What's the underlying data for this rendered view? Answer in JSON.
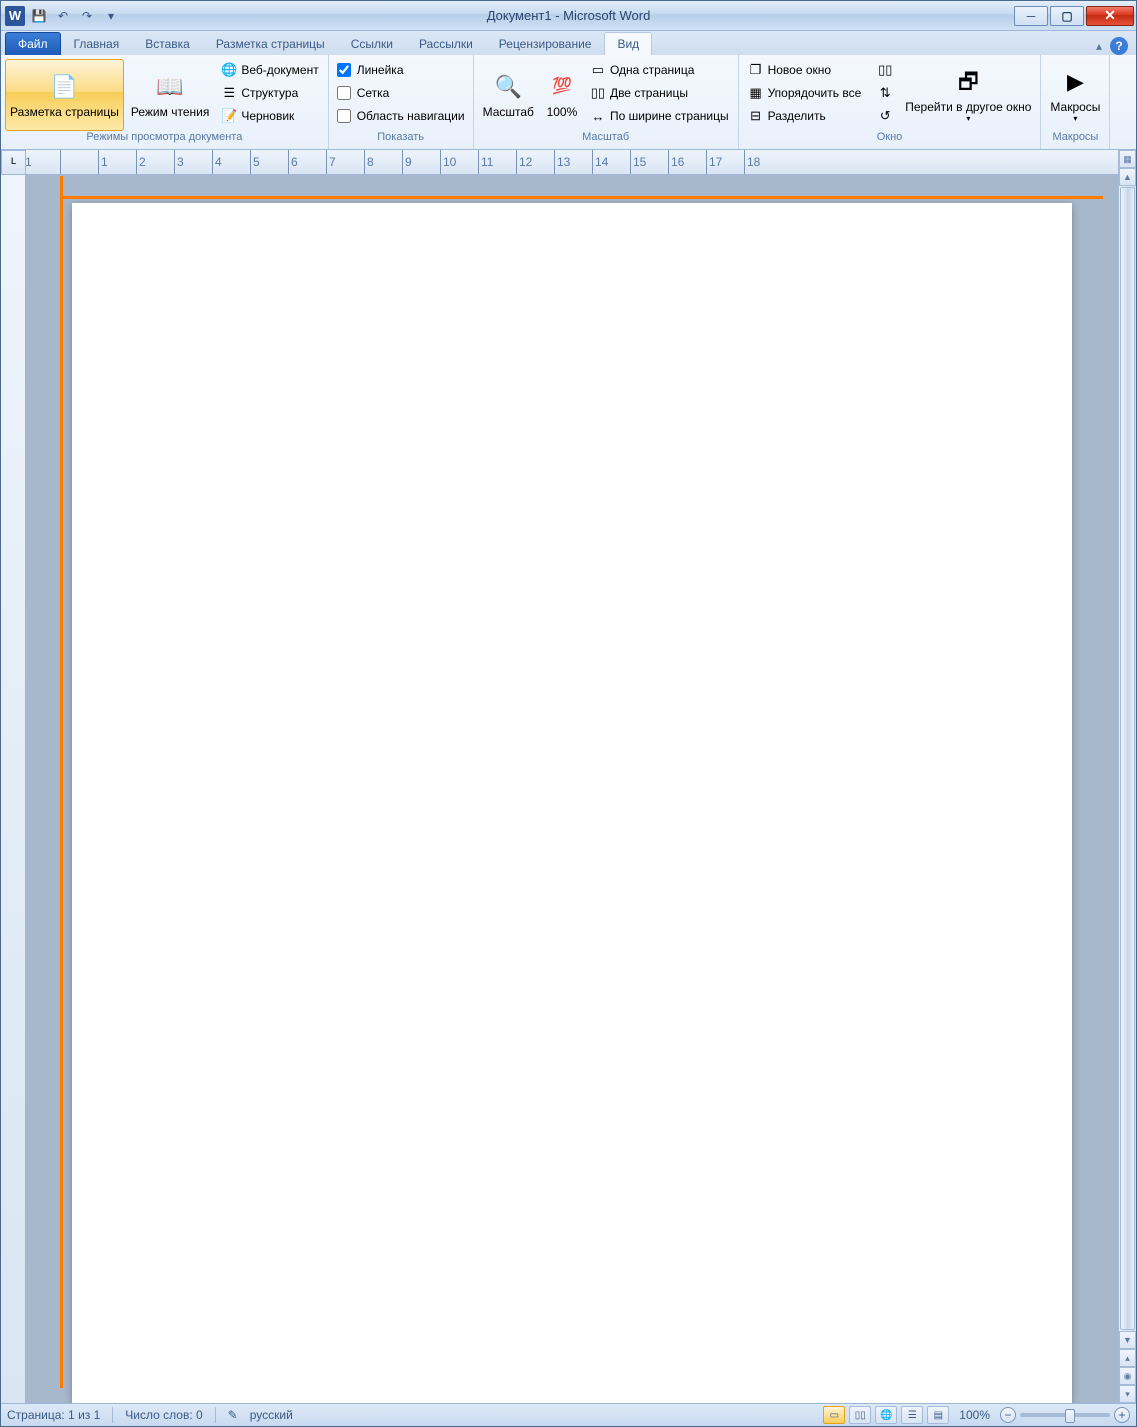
{
  "title": "Документ1 - Microsoft Word",
  "tabs": {
    "file": "Файл",
    "home": "Главная",
    "insert": "Вставка",
    "layout": "Разметка страницы",
    "refs": "Ссылки",
    "mail": "Рассылки",
    "review": "Рецензирование",
    "view": "Вид"
  },
  "ribbon": {
    "views": {
      "label": "Режимы просмотра документа",
      "print": "Разметка страницы",
      "read": "Режим чтения",
      "web": "Веб-документ",
      "outline": "Структура",
      "draft": "Черновик"
    },
    "show": {
      "label": "Показать",
      "ruler": "Линейка",
      "grid": "Сетка",
      "nav": "Область навигации"
    },
    "zoom": {
      "label": "Масштаб",
      "zoom": "Масштаб",
      "hundred": "100%",
      "one": "Одна страница",
      "two": "Две страницы",
      "width": "По ширине страницы"
    },
    "window": {
      "label": "Окно",
      "new": "Новое окно",
      "arrange": "Упорядочить все",
      "split": "Разделить",
      "switch": "Перейти в другое окно"
    },
    "macros": {
      "label": "Макросы",
      "btn": "Макросы"
    }
  },
  "status": {
    "page": "Страница: 1 из 1",
    "words": "Число слов: 0",
    "lang": "русский",
    "zoom": "100%"
  }
}
